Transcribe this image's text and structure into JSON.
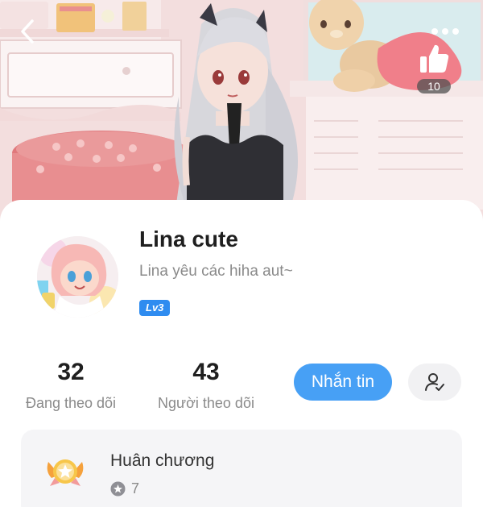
{
  "header": {
    "back_icon": "chevron-left-icon",
    "more_icon": "more-dots-icon",
    "like_icon": "thumbs-up-icon",
    "like_count": "10"
  },
  "profile": {
    "name": "Lina cute",
    "bio": "Lina yêu các hiha aut~",
    "level": "Lv3"
  },
  "stats": {
    "following": {
      "value": "32",
      "label": "Đang theo dõi"
    },
    "followers": {
      "value": "43",
      "label": "Người theo dõi"
    }
  },
  "actions": {
    "message_label": "Nhắn tin",
    "follow_icon": "user-check-icon"
  },
  "medal": {
    "title": "Huân chương",
    "count": "7"
  },
  "colors": {
    "accent_blue": "#47a0f5",
    "level_badge": "#2f8cf0",
    "card_bg": "#f5f5f7"
  }
}
